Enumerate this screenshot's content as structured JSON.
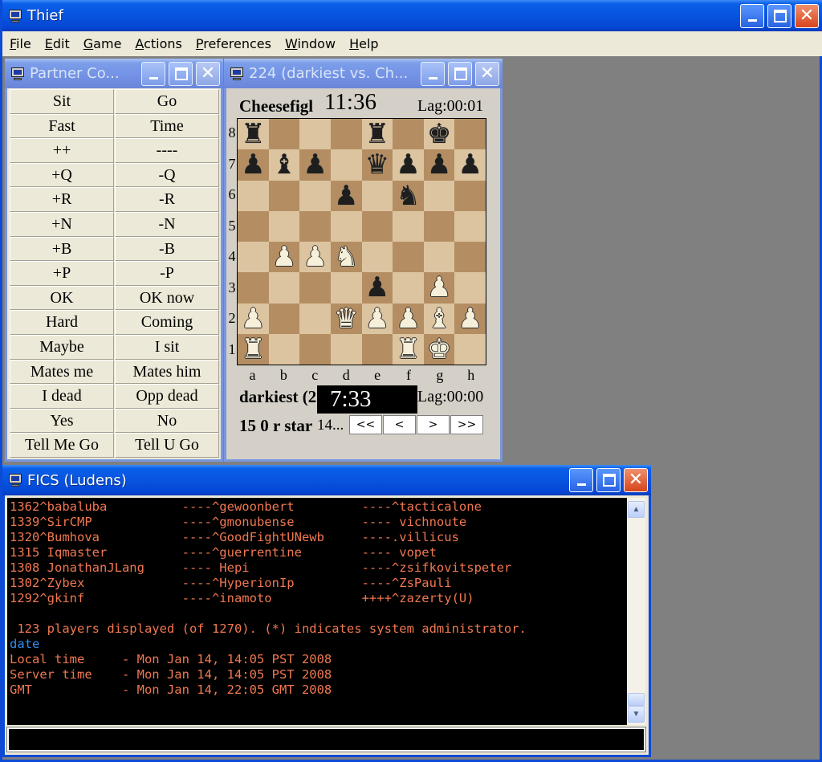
{
  "app": {
    "title": "Thief",
    "menu": [
      "File",
      "Edit",
      "Game",
      "Actions",
      "Preferences",
      "Window",
      "Help"
    ]
  },
  "partner": {
    "title": "Partner Co...",
    "buttons": [
      [
        "Sit",
        "Go"
      ],
      [
        "Fast",
        "Time"
      ],
      [
        "++",
        "----"
      ],
      [
        "+Q",
        "-Q"
      ],
      [
        "+R",
        "-R"
      ],
      [
        "+N",
        "-N"
      ],
      [
        "+B",
        "-B"
      ],
      [
        "+P",
        "-P"
      ],
      [
        "OK",
        "OK now"
      ],
      [
        "Hard",
        "Coming"
      ],
      [
        "Maybe",
        "I sit"
      ],
      [
        "Mates me",
        "Mates him"
      ],
      [
        "I dead",
        "Opp dead"
      ],
      [
        "Yes",
        "No"
      ],
      [
        "Tell Me Go",
        "Tell U Go"
      ]
    ]
  },
  "game": {
    "title": "224 (darkiest vs. Ch...",
    "top_player": "Cheesefigl",
    "top_clock": "11:36",
    "top_lag": "Lag:00:01",
    "bottom_player": "darkiest (2",
    "bottom_clock": "7:33",
    "bottom_lag": "Lag:00:00",
    "game_info": "15 0 r star",
    "move_text": "14...",
    "nav": [
      "<<",
      "<",
      ">",
      ">>"
    ],
    "ranks": [
      "8",
      "7",
      "6",
      "5",
      "4",
      "3",
      "2",
      "1"
    ],
    "files": [
      "a",
      "b",
      "c",
      "d",
      "e",
      "f",
      "g",
      "h"
    ],
    "board": [
      [
        "bR",
        "",
        "",
        "",
        "bR",
        "",
        "bK",
        ""
      ],
      [
        "bP",
        "bB",
        "bP",
        "",
        "bQ",
        "bP",
        "bP",
        "bP"
      ],
      [
        "",
        "",
        "",
        "bP",
        "",
        "bN",
        "",
        ""
      ],
      [
        "",
        "",
        "",
        "",
        "",
        "",
        "",
        ""
      ],
      [
        "",
        "wP",
        "wP",
        "wN",
        "",
        "",
        "",
        ""
      ],
      [
        "",
        "",
        "",
        "",
        "bP",
        "",
        "wP",
        ""
      ],
      [
        "wP",
        "",
        "",
        "wQ",
        "wP",
        "wP",
        "wB",
        "wP"
      ],
      [
        "wR",
        "",
        "",
        "",
        "",
        "wR",
        "wK",
        ""
      ]
    ]
  },
  "fics": {
    "title": "FICS (Ludens)",
    "lines": [
      {
        "text": "1362^babaluba          ----^gewoonbert         ----^tacticalone",
        "kind": "out"
      },
      {
        "text": "1339^SirCMP            ----^gmonubense         ---- vichnoute",
        "kind": "out"
      },
      {
        "text": "1320^Bumhova           ----^GoodFightUNewb     ----.villicus",
        "kind": "out"
      },
      {
        "text": "1315 Iqmaster          ----^guerrentine        ---- vopet",
        "kind": "out"
      },
      {
        "text": "1308 JonathanJLang     ---- Hepi               ----^zsifkovitspeter",
        "kind": "out"
      },
      {
        "text": "1302^Zybex             ----^HyperionIp         ----^ZsPauli",
        "kind": "out"
      },
      {
        "text": "1292^gkinf             ----^inamoto            ++++^zazerty(U)",
        "kind": "out"
      },
      {
        "text": "",
        "kind": "out"
      },
      {
        "text": " 123 players displayed (of 1270). (*) indicates system administrator.",
        "kind": "out"
      },
      {
        "text": "date",
        "kind": "cmd"
      },
      {
        "text": "Local time     - Mon Jan 14, 14:05 PST 2008",
        "kind": "out"
      },
      {
        "text": "Server time    - Mon Jan 14, 14:05 PST 2008",
        "kind": "out"
      },
      {
        "text": "GMT            - Mon Jan 14, 22:05 GMT 2008",
        "kind": "out"
      }
    ],
    "input_value": ""
  },
  "icons": {
    "window": "monitor-icon",
    "minimize": "minimize-icon",
    "maximize": "maximize-icon",
    "close": "close-icon"
  },
  "colors": {
    "titlebar": "#0754e0",
    "console_text": "#f07850",
    "console_cmd": "#2f8cf0",
    "board_light": "#dcc4a0",
    "board_dark": "#b48e62"
  }
}
